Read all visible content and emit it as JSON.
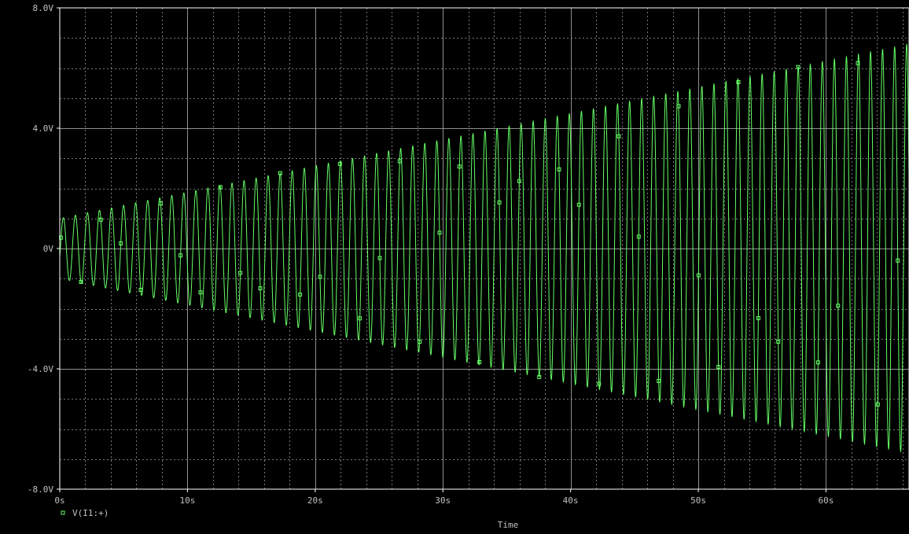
{
  "chart_data": {
    "type": "line",
    "title": "",
    "xlabel": "Time",
    "ylabel": "",
    "xlim": [
      0,
      66.5
    ],
    "ylim": [
      -8,
      8
    ],
    "x_ticks": [
      {
        "value": 0,
        "label": "0s"
      },
      {
        "value": 10,
        "label": "10s"
      },
      {
        "value": 20,
        "label": "20s"
      },
      {
        "value": 30,
        "label": "30s"
      },
      {
        "value": 40,
        "label": "40s"
      },
      {
        "value": 50,
        "label": "50s"
      },
      {
        "value": 60,
        "label": "60s"
      }
    ],
    "y_ticks": [
      {
        "value": 8,
        "label": "8.0V"
      },
      {
        "value": 4,
        "label": "4.0V"
      },
      {
        "value": 0,
        "label": "0V"
      },
      {
        "value": -4,
        "label": "-4.0V"
      },
      {
        "value": -8,
        "label": "-8.0V"
      }
    ],
    "grid": true,
    "legend_position": "bottom-left",
    "series": [
      {
        "name": "V(I1:+)",
        "color": "#66ff66",
        "marker": "square",
        "signal": {
          "kind": "growing_sinusoid",
          "amplitude_start": 1.0,
          "amplitude_end": 6.8,
          "cycles_per_second": 1.0,
          "start": 0,
          "end": 66.5
        }
      }
    ]
  },
  "colors": {
    "background": "#000000",
    "plot_border": "#ffffff",
    "grid": "#a0a0a0",
    "text": "#c0c0c0",
    "trace": "#66ff66"
  }
}
